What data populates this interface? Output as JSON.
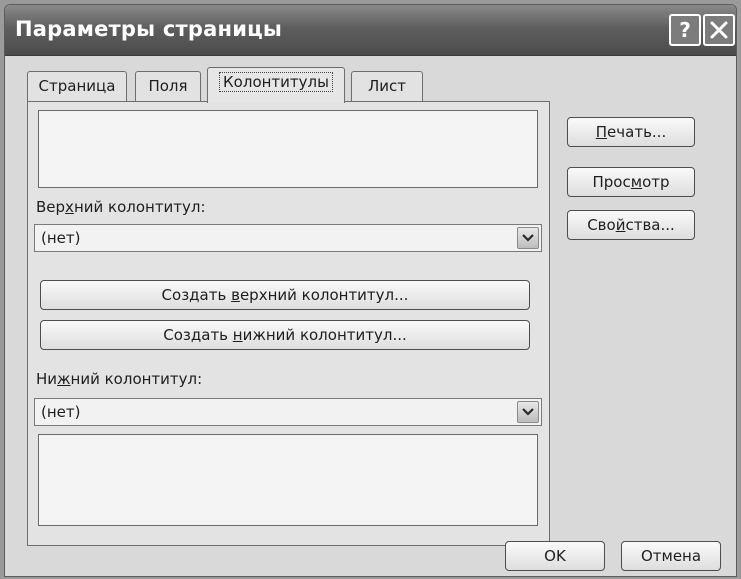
{
  "window": {
    "title": "Параметры страницы"
  },
  "titlebar_buttons": {
    "help": "?"
  },
  "tabs": [
    {
      "label": "Страница",
      "active": false
    },
    {
      "label": "Поля",
      "active": false
    },
    {
      "label": "Колонтитулы",
      "active": true
    },
    {
      "label": "Лист",
      "active": false
    }
  ],
  "header": {
    "label_pre": "Вер",
    "label_accel": "х",
    "label_post": "ний колонтитул:",
    "value": "(нет)",
    "create_pre": "Создать ",
    "create_accel": "в",
    "create_post": "ерхний колонтитул..."
  },
  "footer": {
    "create_pre": "Создать ",
    "create_accel": "н",
    "create_post": "ижний колонтитул...",
    "label_pre": "Ни",
    "label_accel": "ж",
    "label_post": "ний колонтитул:",
    "value": "(нет)"
  },
  "side_buttons": {
    "print_accel": "П",
    "print_post": "ечать...",
    "preview_pre": "Прос",
    "preview_accel": "м",
    "preview_post": "отр",
    "props_pre": "Сво",
    "props_accel": "й",
    "props_post": "ства..."
  },
  "footer_buttons": {
    "ok": "OK",
    "cancel": "Отмена"
  }
}
